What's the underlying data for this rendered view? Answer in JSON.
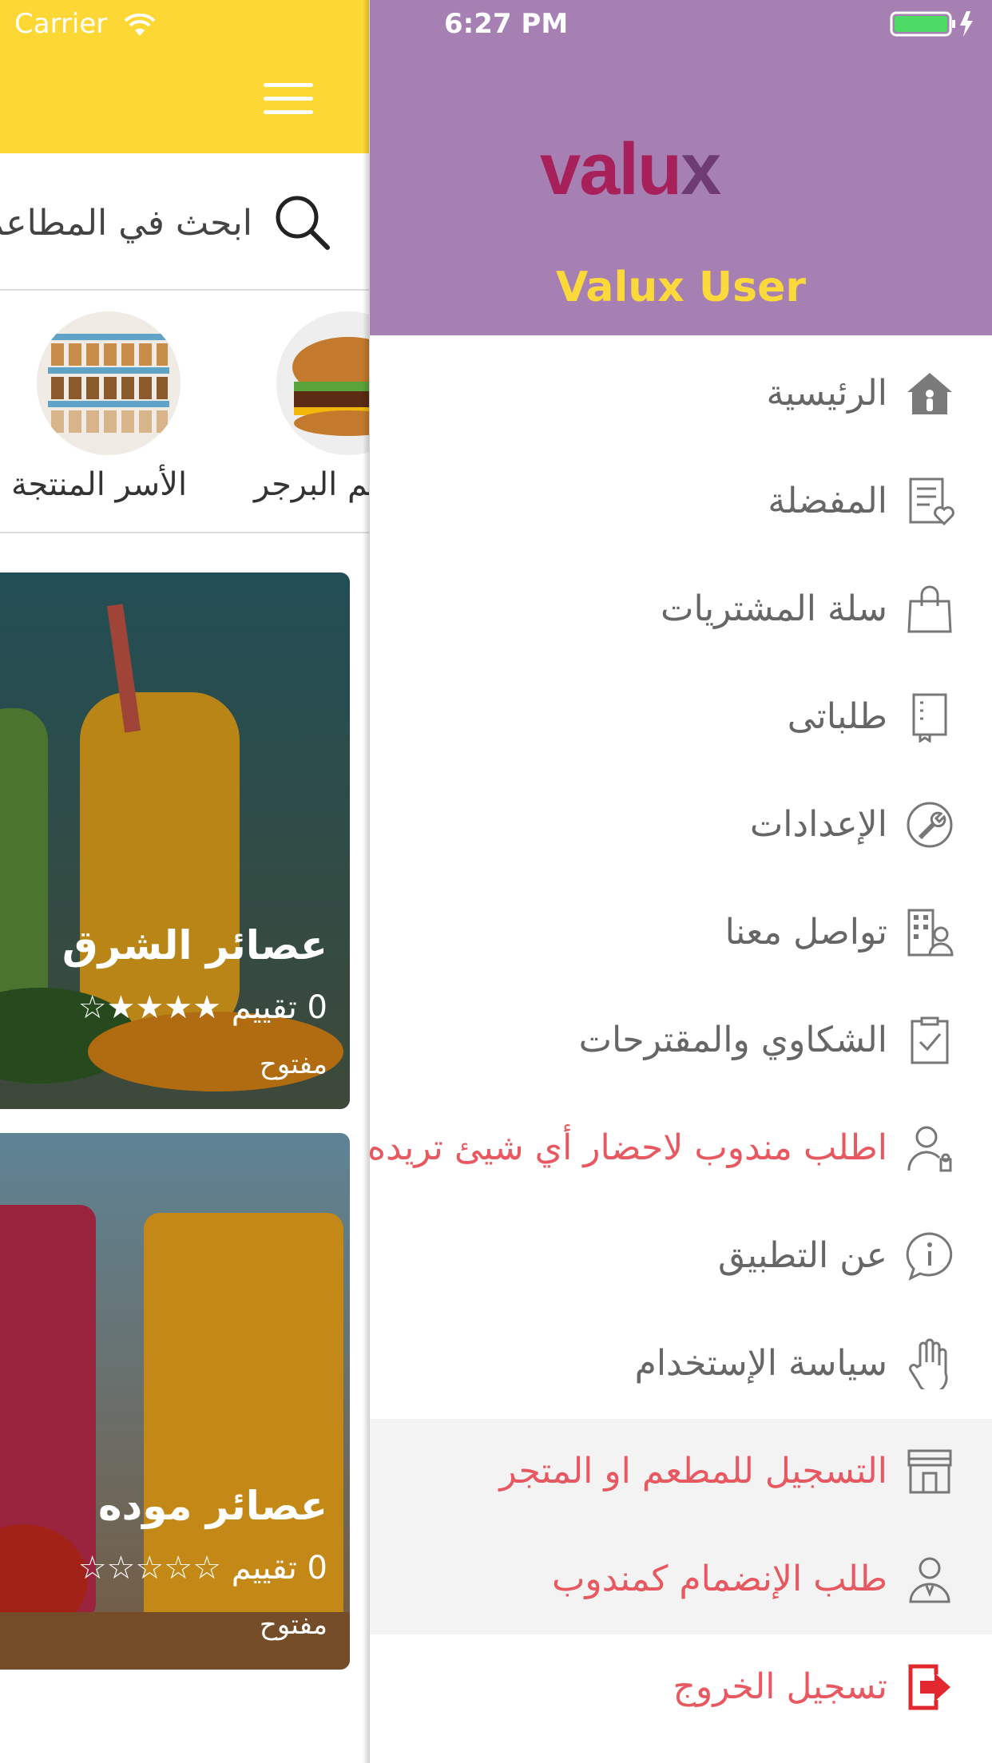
{
  "status_bar": {
    "carrier": "Carrier",
    "time": "6:27 PM"
  },
  "search": {
    "placeholder": "ابحث في المطاعم"
  },
  "categories": [
    {
      "label": "الأسر المنتجة",
      "icon": "family-products-image"
    },
    {
      "label": "مطاعم البرجر",
      "icon": "burger-image"
    }
  ],
  "cards": [
    {
      "title": "عصائر الشرق",
      "rating_count": "0 تقييم",
      "stars": "★★★★☆",
      "status": "مفتوح"
    },
    {
      "title": "عصائر موده",
      "rating_count": "0 تقييم",
      "stars": "☆☆☆☆☆",
      "status": "مفتوح"
    }
  ],
  "drawer": {
    "logo": "valux",
    "user_name": "Valux User",
    "menu": [
      {
        "label": "الرئيسية",
        "icon": "home-icon"
      },
      {
        "label": "المفضلة",
        "icon": "favorites-icon"
      },
      {
        "label": "سلة المشتريات",
        "icon": "shopping-bag-icon"
      },
      {
        "label": "طلباتى",
        "icon": "orders-icon"
      },
      {
        "label": "الإعدادات",
        "icon": "settings-icon"
      },
      {
        "label": "تواصل معنا",
        "icon": "contact-icon"
      },
      {
        "label": "الشكاوي والمقترحات",
        "icon": "complaints-icon"
      },
      {
        "label": "اطلب مندوب لاحضار أي شيئ تريده",
        "icon": "delegate-icon"
      },
      {
        "label": "عن التطبيق",
        "icon": "info-icon"
      },
      {
        "label": "سياسة الإستخدام",
        "icon": "hand-icon"
      },
      {
        "label": "التسجيل للمطعم او المتجر",
        "icon": "store-icon"
      },
      {
        "label": "طلب الإنضمام كمندوب",
        "icon": "courier-icon"
      },
      {
        "label": "تسجيل الخروج",
        "icon": "logout-icon"
      }
    ]
  },
  "colors": {
    "header_yellow": "#fdd835",
    "drawer_purple": "#a67fb3",
    "accent_red": "#e85860",
    "user_yellow": "#fcd93b"
  }
}
